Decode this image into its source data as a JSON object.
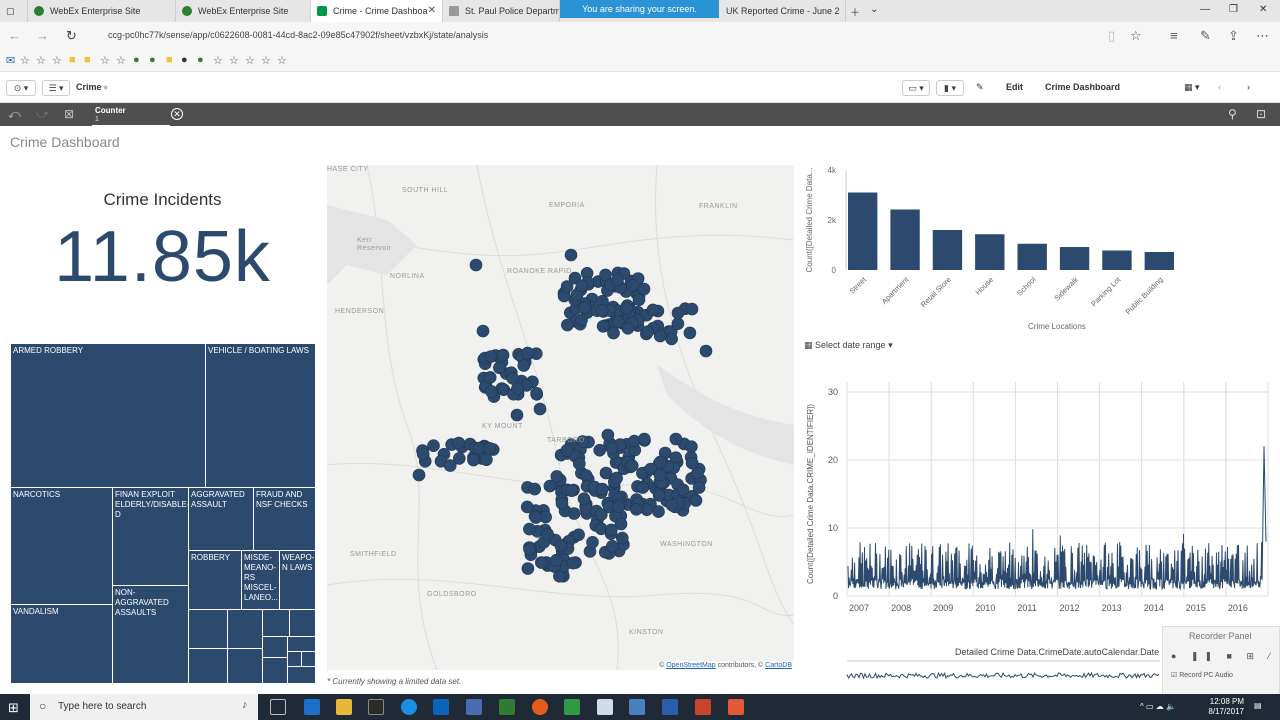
{
  "browser": {
    "tabs": [
      {
        "label": "WebEx Enterprise Site",
        "color": "#2e7d32"
      },
      {
        "label": "WebEx Enterprise Site",
        "color": "#2e7d32"
      },
      {
        "label": "Crime - Crime Dashboa",
        "color": "#009845"
      },
      {
        "label": "St. Paul Police Departme",
        "color": "#888888"
      },
      {
        "label": "UK Reported Crime - June 2",
        "color": "#888888"
      }
    ],
    "sharing_banner": "You are sharing your screen.",
    "url": "ccg-pc0hc77k/sense/app/c0622608-0081-44cd-8ac2-09e85c47902f/sheet/vzbxKj/state/analysis"
  },
  "qlik_toolbar": {
    "app_name": "Crime",
    "edit_label": "Edit",
    "sheet_name": "Crime Dashboard"
  },
  "selections": {
    "field": "Counter",
    "value": "1"
  },
  "sheet": {
    "title": "Crime Dashboard",
    "kpi_title": "Crime Incidents",
    "kpi_value": "11.85k",
    "map_note": "* Currently showing a limited data set.",
    "map_attr": {
      "copy": "© ",
      "osm": "OpenStreetMap",
      "middle": " contributors, © ",
      "carto": "CartoDB"
    },
    "map_labels": [
      "HASE CITY",
      "SOUTH HILL",
      "EMPORIA",
      "FRANKLIN",
      "Kerr Reservoir",
      "NORLINA",
      "ROANOKE RAPID",
      "HENDERSON",
      "SMITHFIELD",
      "GOLDSBORO",
      "WASHINGTON",
      "KINSTON",
      "TARBORO",
      "KY MOUNT"
    ],
    "date_range_label": "Select date range",
    "treemap": [
      "ARMED ROBBERY",
      "VEHICLE / BOATING LAWS",
      "NARCOTICS",
      "FINAN EXPLOIT ELDERLY/DISABLE-D",
      "AGGRAVATED ASSAULT",
      "FRAUD AND NSF CHECKS",
      "ROBBERY",
      "MISDE-MEANO-RS MISCEL-LANEO...",
      "WEAPO-N LAWS",
      "NON-AGGRAVATED ASSAULTS",
      "VANDALISM"
    ],
    "recorder": {
      "title": "Recorder Panel",
      "audio_label": "Record PC Audio"
    }
  },
  "chart_data": [
    {
      "type": "bar",
      "title": "",
      "xlabel": "Crime Locations",
      "ylabel": "Count([Detailed Crime Data...",
      "categories": [
        "Street",
        "Apartment",
        "Retail Store",
        "House",
        "School",
        "Sidewalk",
        "Parking Lot",
        "Public Building"
      ],
      "values": [
        3100,
        2420,
        1600,
        1430,
        1050,
        920,
        780,
        720
      ],
      "ylim": [
        0,
        4000
      ],
      "yticks": [
        "0",
        "2k",
        "4k"
      ],
      "color": "#2c4a6e"
    },
    {
      "type": "line",
      "title": "",
      "xlabel": "",
      "ylabel": "Count([Detailed Crime Data.CRIME_IDENTIFIER])",
      "x_range": [
        "2007",
        "2016"
      ],
      "xticks": [
        "2007",
        "2008",
        "2009",
        "2010",
        "2011",
        "2012",
        "2013",
        "2014",
        "2015",
        "2016"
      ],
      "yticks": [
        "0",
        "10",
        "20",
        "30"
      ],
      "ylim": [
        0,
        30
      ],
      "typical_daily_range": [
        1,
        8
      ],
      "peak_value": 22,
      "grid": true,
      "color": "#2c4a6e",
      "slider_label": "Detailed Crime Data.CrimeDate.autoCalendar.Date"
    }
  ],
  "taskbar": {
    "search_placeholder": "Type here to search",
    "time": "12:08 PM",
    "date": "8/17/2017"
  }
}
